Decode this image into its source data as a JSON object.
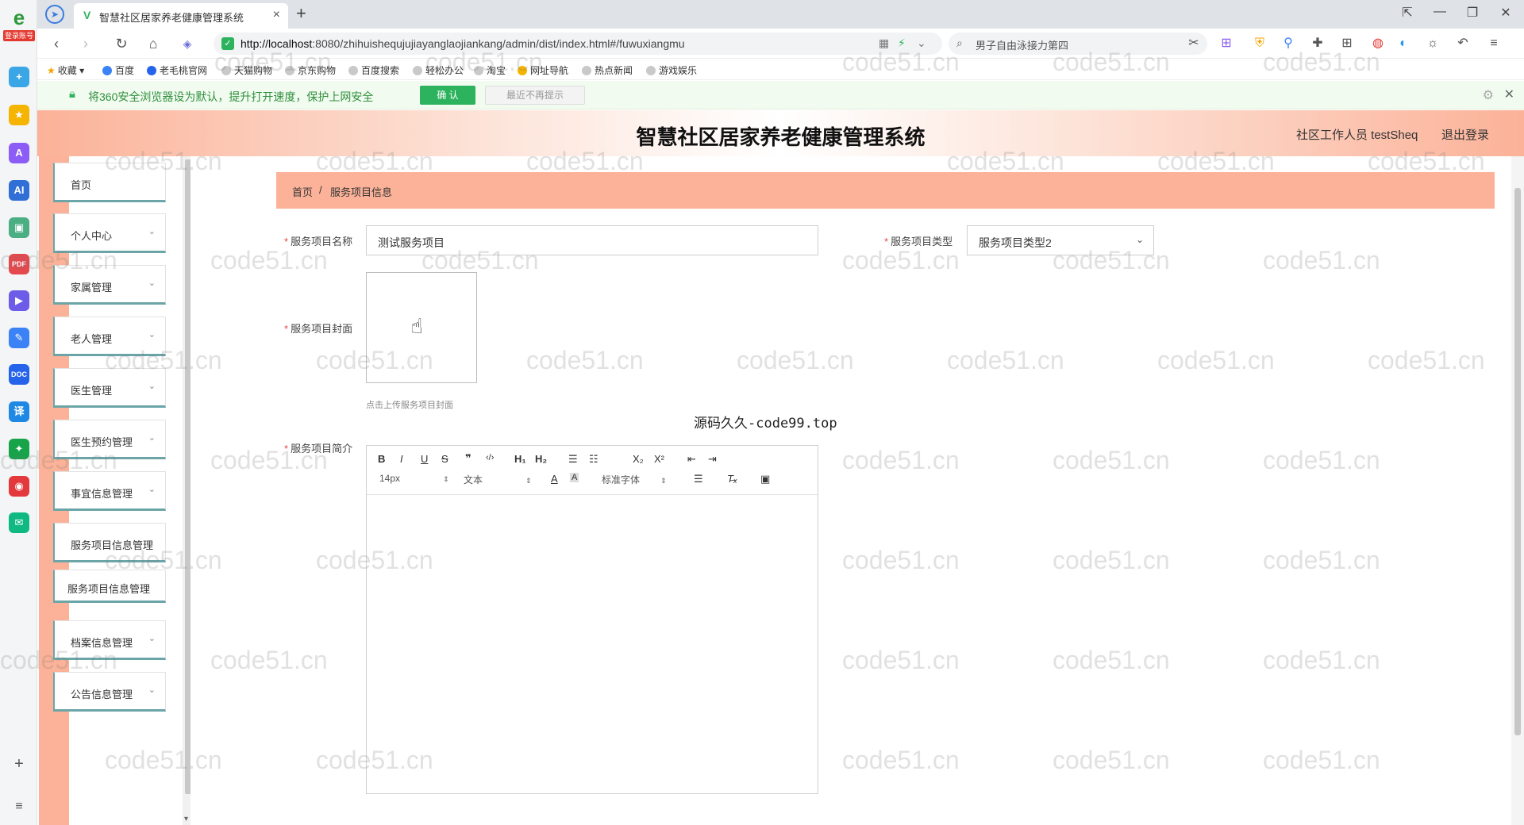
{
  "browser": {
    "sidebar_logo_tag": "登录账号",
    "tab": {
      "title": "智慧社区居家养老健康管理系统"
    },
    "url": {
      "host": "http://localhost",
      "rest": ":8080/zhihuishequjujiayanglaojiankang/admin/dist/index.html#/fuwuxiangmu"
    },
    "search_query": "男子自由泳接力第四",
    "bookmarks": [
      "收藏",
      "百度",
      "老毛桃官网",
      "天猫购物",
      "京东购物",
      "百度搜索",
      "轻松办公",
      "淘宝",
      "网址导航",
      "热点新闻",
      "游戏娱乐"
    ],
    "notice": {
      "message": "将360安全浏览器设为默认，提升打开速度，保护上网安全",
      "confirm": "确 认",
      "dismiss": "最近不再提示"
    }
  },
  "app": {
    "title": "智慧社区居家养老健康管理系统",
    "user": "社区工作人员 testSheq",
    "logout": "退出登录",
    "menu": [
      {
        "label": "首页",
        "has_chevron": false
      },
      {
        "label": "个人中心",
        "has_chevron": true
      },
      {
        "label": "家属管理",
        "has_chevron": true
      },
      {
        "label": "老人管理",
        "has_chevron": true
      },
      {
        "label": "医生管理",
        "has_chevron": true
      },
      {
        "label": "医生预约管理",
        "has_chevron": true
      },
      {
        "label": "事宜信息管理",
        "has_chevron": true
      },
      {
        "label": "服务项目信息管理",
        "has_chevron": false
      },
      {
        "label": "服务项目信息管理",
        "has_chevron": false
      },
      {
        "label": "档案信息管理",
        "has_chevron": true
      },
      {
        "label": "公告信息管理",
        "has_chevron": true
      }
    ],
    "breadcrumb": {
      "home": "首页",
      "separator": "/",
      "current": "服务项目信息"
    },
    "form": {
      "name_label": "服务项目名称",
      "name_value": "测试服务项目",
      "type_label": "服务项目类型",
      "type_value": "服务项目类型2",
      "cover_label": "服务项目封面",
      "cover_hint": "点击上传服务项目封面",
      "intro_label": "服务项目简介"
    },
    "editor": {
      "font_size": "14px",
      "paragraph": "文本",
      "font_family": "标准字体"
    },
    "overlay_text": "源码久久-code99.top",
    "watermark": "code51.cn"
  },
  "colors": {
    "accent": "#fbb298",
    "menu_border": "#6ba5a8",
    "confirm_green": "#2db35d",
    "required": "#e34949"
  }
}
